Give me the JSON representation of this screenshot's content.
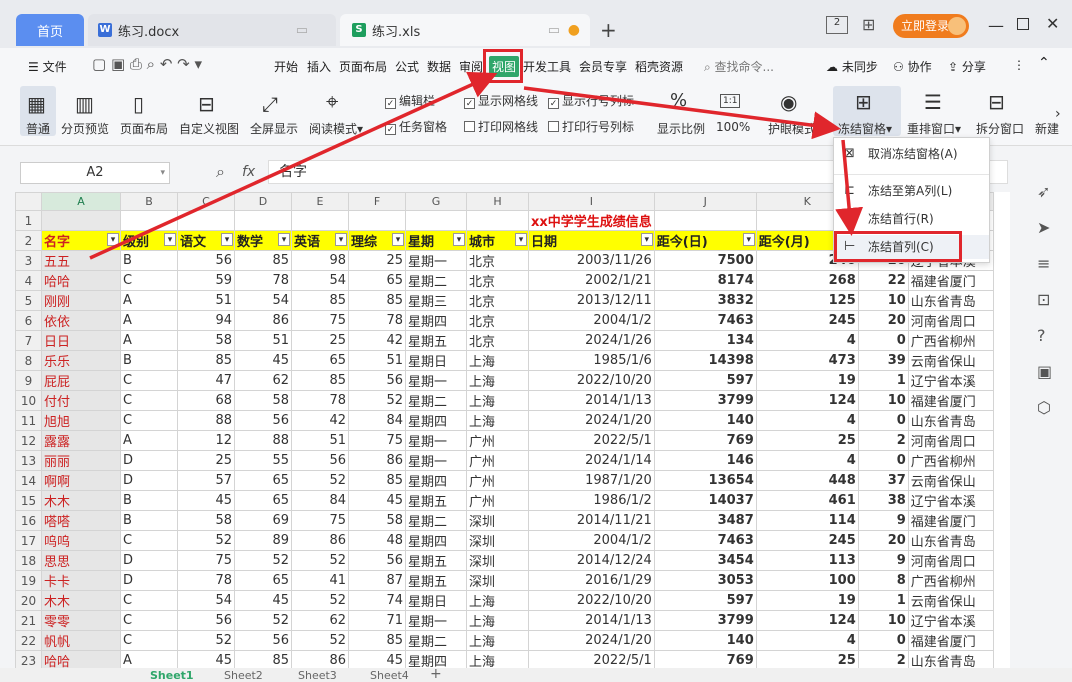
{
  "tabs": {
    "home": "首页",
    "doc": "练习.docx",
    "xls": "练习.xls"
  },
  "window": {
    "login": "立即登录"
  },
  "menu": {
    "file": "文件",
    "items": [
      "开始",
      "插入",
      "页面布局",
      "公式",
      "数据",
      "审阅",
      "视图",
      "开发工具",
      "会员专享",
      "稻壳资源"
    ],
    "search": "查找命令...",
    "unsync": "未同步",
    "collab": "协作",
    "share": "分享"
  },
  "ribbon": {
    "normal": "普通",
    "pagebreak": "分页预览",
    "pagelayout": "页面布局",
    "custom": "自定义视图",
    "fullscreen": "全屏显示",
    "reading": "阅读模式",
    "editbar": "编辑栏",
    "showgrid": "显示网格线",
    "showheaders": "显示行号列标",
    "taskpane": "任务窗格",
    "printgrid": "打印网格线",
    "printheaders": "打印行号列标",
    "zoomlbl": "显示比例",
    "zoom": "100%",
    "eye": "护眼模式",
    "freeze": "冻结窗格",
    "rearrange": "重排窗口",
    "split": "拆分窗口",
    "new": "新建"
  },
  "formula": {
    "cell": "A2",
    "fx": "fx",
    "value": "名字"
  },
  "dropdown": {
    "unfreeze": "取消冻结窗格(A)",
    "freezeA": "冻结至第A列(L)",
    "firstrow": "冻结首行(R)",
    "firstcol": "冻结首列(C)"
  },
  "sheet": {
    "title": "xx中学学生成绩信息",
    "cols": [
      "A",
      "B",
      "C",
      "D",
      "E",
      "F",
      "G",
      "H",
      "I",
      "J",
      "K",
      "L"
    ],
    "headers": [
      "名字",
      "级别",
      "语文",
      "数学",
      "英语",
      "理综",
      "星期",
      "城市",
      "日期",
      "距今(日)",
      "距今(月)",
      ""
    ],
    "rows": [
      [
        "五五",
        "B",
        "56",
        "85",
        "98",
        "25",
        "星期一",
        "北京",
        "2003/11/26",
        "7500",
        "246",
        "20",
        "辽宁省本溪"
      ],
      [
        "哈哈",
        "C",
        "59",
        "78",
        "54",
        "65",
        "星期二",
        "北京",
        "2002/1/21",
        "8174",
        "268",
        "22",
        "福建省厦门"
      ],
      [
        "刚刚",
        "A",
        "51",
        "54",
        "85",
        "85",
        "星期三",
        "北京",
        "2013/12/11",
        "3832",
        "125",
        "10",
        "山东省青岛"
      ],
      [
        "依依",
        "A",
        "94",
        "86",
        "75",
        "78",
        "星期四",
        "北京",
        "2004/1/2",
        "7463",
        "245",
        "20",
        "河南省周口"
      ],
      [
        "日日",
        "A",
        "58",
        "51",
        "25",
        "42",
        "星期五",
        "北京",
        "2024/1/26",
        "134",
        "4",
        "0",
        "广西省柳州"
      ],
      [
        "乐乐",
        "B",
        "85",
        "45",
        "65",
        "51",
        "星期日",
        "上海",
        "1985/1/6",
        "14398",
        "473",
        "39",
        "云南省保山"
      ],
      [
        "屁屁",
        "C",
        "47",
        "62",
        "85",
        "56",
        "星期一",
        "上海",
        "2022/10/20",
        "597",
        "19",
        "1",
        "辽宁省本溪"
      ],
      [
        "付付",
        "C",
        "68",
        "58",
        "78",
        "52",
        "星期二",
        "上海",
        "2014/1/13",
        "3799",
        "124",
        "10",
        "福建省厦门"
      ],
      [
        "旭旭",
        "C",
        "88",
        "56",
        "42",
        "84",
        "星期四",
        "上海",
        "2024/1/20",
        "140",
        "4",
        "0",
        "山东省青岛"
      ],
      [
        "露露",
        "A",
        "12",
        "88",
        "51",
        "75",
        "星期一",
        "广州",
        "2022/5/1",
        "769",
        "25",
        "2",
        "河南省周口"
      ],
      [
        "丽丽",
        "D",
        "25",
        "55",
        "56",
        "86",
        "星期一",
        "广州",
        "2024/1/14",
        "146",
        "4",
        "0",
        "广西省柳州"
      ],
      [
        "啊啊",
        "D",
        "57",
        "65",
        "52",
        "85",
        "星期四",
        "广州",
        "1987/1/20",
        "13654",
        "448",
        "37",
        "云南省保山"
      ],
      [
        "木木",
        "B",
        "45",
        "65",
        "84",
        "45",
        "星期五",
        "广州",
        "1986/1/2",
        "14037",
        "461",
        "38",
        "辽宁省本溪"
      ],
      [
        "嗒嗒",
        "B",
        "58",
        "69",
        "75",
        "58",
        "星期二",
        "深圳",
        "2014/11/21",
        "3487",
        "114",
        "9",
        "福建省厦门"
      ],
      [
        "呜呜",
        "C",
        "52",
        "89",
        "86",
        "48",
        "星期四",
        "深圳",
        "2004/1/2",
        "7463",
        "245",
        "20",
        "山东省青岛"
      ],
      [
        "思思",
        "D",
        "75",
        "52",
        "52",
        "56",
        "星期五",
        "深圳",
        "2014/12/24",
        "3454",
        "113",
        "9",
        "河南省周口"
      ],
      [
        "卡卡",
        "D",
        "78",
        "65",
        "41",
        "87",
        "星期五",
        "深圳",
        "2016/1/29",
        "3053",
        "100",
        "8",
        "广西省柳州"
      ],
      [
        "木木",
        "C",
        "54",
        "45",
        "52",
        "74",
        "星期日",
        "上海",
        "2022/10/20",
        "597",
        "19",
        "1",
        "云南省保山"
      ],
      [
        "零零",
        "C",
        "56",
        "52",
        "62",
        "71",
        "星期一",
        "上海",
        "2014/1/13",
        "3799",
        "124",
        "10",
        "辽宁省本溪"
      ],
      [
        "帆帆",
        "C",
        "52",
        "56",
        "52",
        "85",
        "星期二",
        "上海",
        "2024/1/20",
        "140",
        "4",
        "0",
        "福建省厦门"
      ],
      [
        "哈哈",
        "A",
        "45",
        "85",
        "86",
        "45",
        "星期四",
        "上海",
        "2022/5/1",
        "769",
        "25",
        "2",
        "山东省青岛"
      ]
    ]
  },
  "sheets": [
    "Sheet1",
    "Sheet2",
    "Sheet3",
    "Sheet4"
  ],
  "colors": {
    "accent": "#5b8ef0",
    "highlight": "#e0262c",
    "header_fill": "#ffff00",
    "name_red": "#cc2222",
    "title_red": "#dd1111"
  }
}
